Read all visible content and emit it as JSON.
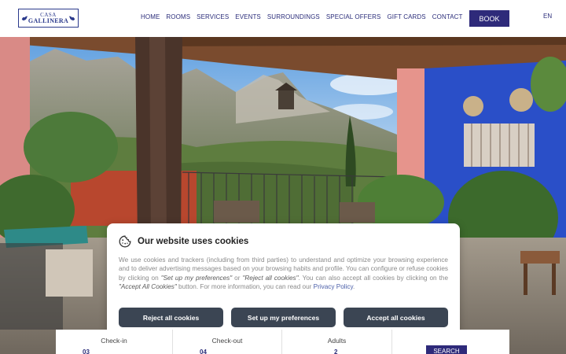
{
  "brand": {
    "logo_line1": "CASA",
    "logo_line2": "GALLINERA"
  },
  "nav": {
    "items": [
      "HOME",
      "ROOMS",
      "SERVICES",
      "EVENTS",
      "SURROUNDINGS",
      "SPECIAL OFFERS",
      "GIFT CARDS",
      "CONTACT"
    ],
    "book_label": "BOOK",
    "language": "EN"
  },
  "cookie": {
    "title": "Our website uses cookies",
    "body_1": "We use cookies and trackers (including from third parties) to understand and optimize your browsing experience and to deliver advertising messages based on your browsing habits and profile. You can configure or refuse cookies by clicking on ",
    "q1": "\"Set up my preferences\"",
    "body_2": " or ",
    "q2": "\"Reject all cookies\"",
    "body_3": ". You can also accept all cookies by clicking on the ",
    "q3": "\"Accept All Cookies\"",
    "body_4": " button. For more information, you can read our ",
    "policy_link": "Privacy Policy",
    "body_5": ".",
    "reject_label": "Reject all cookies",
    "prefs_label": "Set up my preferences",
    "accept_label": "Accept all cookies"
  },
  "booking": {
    "checkin_label": "Check-in",
    "checkout_label": "Check-out",
    "adults_label": "Adults",
    "checkin_value": "03",
    "checkout_value": "04",
    "adults_value": "2",
    "search_label": "SEARCH"
  },
  "colors": {
    "brand": "#2e2a7a",
    "cookie_button": "#3b4553"
  },
  "icons": [
    "bird-icon",
    "cookie-icon"
  ]
}
